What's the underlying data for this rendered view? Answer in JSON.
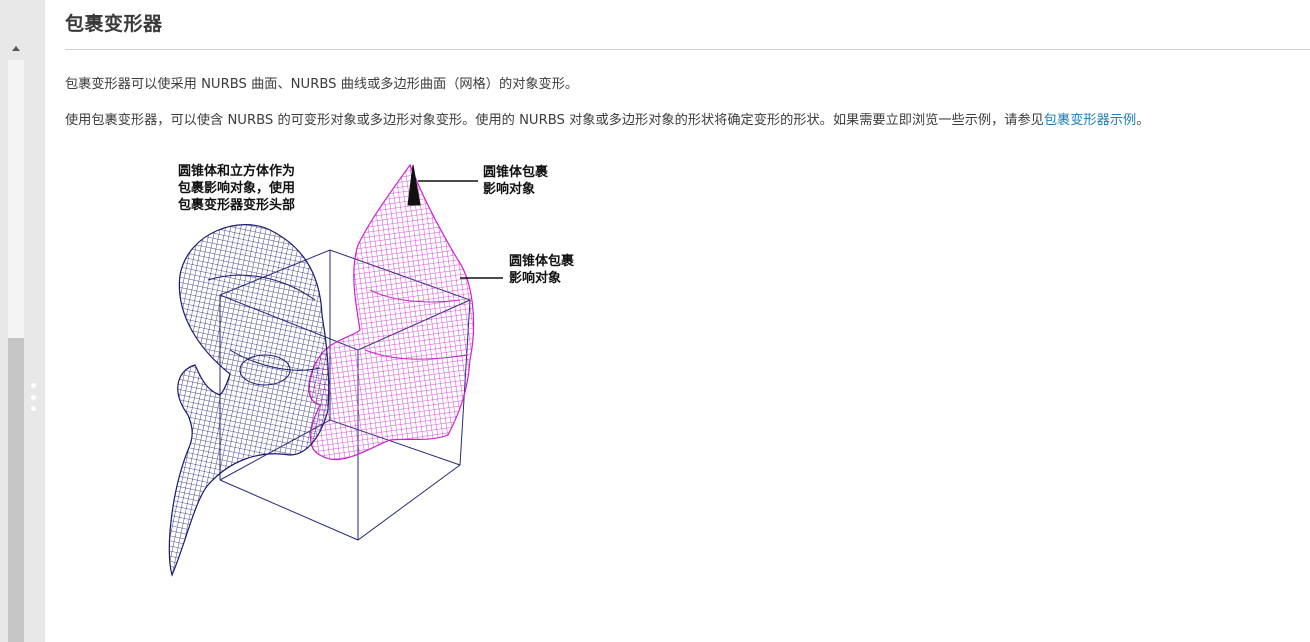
{
  "page": {
    "title": "包裹变形器",
    "paragraph1": "包裹变形器可以使采用 NURBS 曲面、NURBS 曲线或多边形曲面（网格）的对象变形。",
    "paragraph2_before_link": "使用包裹变形器，可以使含 NURBS 的可变形对象或多边形对象变形。使用的 NURBS 对象或多边形对象的形状将确定变形的形状。如果需要立即浏览一些示例，请参见",
    "paragraph2_link": "包裹变形器示例",
    "paragraph2_after_link": "。"
  },
  "figure": {
    "label_left": [
      "圆锥体和立方体作为",
      "包裹影响对象，使用",
      "包裹变形器变形头部"
    ],
    "label_top": [
      "圆锥体包裹",
      "影响对象"
    ],
    "label_mid": [
      "圆锥体包裹",
      "影响对象"
    ],
    "colors": {
      "original_head": "#1a1a6e",
      "deformed_head": "#cc22cc",
      "cube": "#2a2a7a",
      "cone": "#111111",
      "link": "#1c7fb8"
    }
  }
}
